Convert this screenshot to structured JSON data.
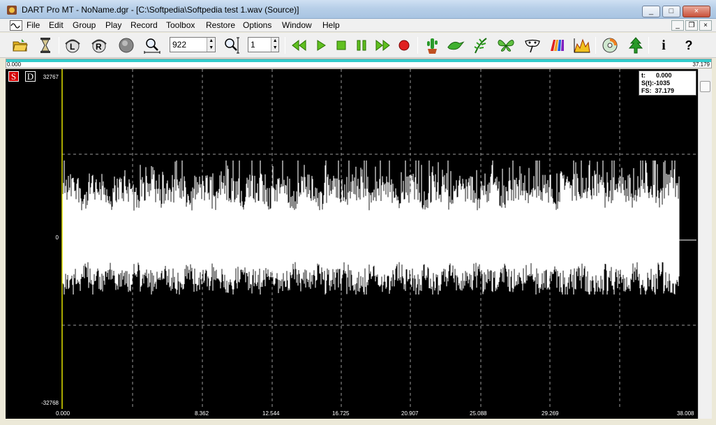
{
  "window": {
    "title": "DART Pro MT - NoName.dgr - [C:\\Softpedia\\Softpedia test 1.wav (Source)]",
    "minimize_label": "_",
    "maximize_label": "□",
    "close_label": "×"
  },
  "menu": {
    "items": [
      "File",
      "Edit",
      "Group",
      "Play",
      "Record",
      "Toolbox",
      "Restore",
      "Options",
      "Window",
      "Help"
    ],
    "mdi_minimize": "_",
    "mdi_restore": "❐",
    "mdi_close": "×"
  },
  "toolbar": {
    "zoom_value": "922",
    "channel_value": "1",
    "help_icon_label": "i",
    "question_label": "?"
  },
  "ruler": {
    "start": "0.000",
    "end": "37.179",
    "progress": 1.0
  },
  "plot": {
    "s_label": "S",
    "d_label": "D",
    "y_max_label": "32767",
    "y_zero_label": "0",
    "y_min_label": "-32768",
    "x_labels": [
      "0.000",
      "8.362",
      "12.544",
      "16.725",
      "20.907",
      "25.088",
      "29.269",
      "38.008"
    ],
    "info": {
      "t": "t:      0.000",
      "s": "S(t):-1035",
      "fs": "FS:  37.179"
    }
  },
  "colors": {
    "accent": "#33cccc",
    "cursor": "#e0e000",
    "waveform": "#ffffff",
    "background": "#000000"
  }
}
